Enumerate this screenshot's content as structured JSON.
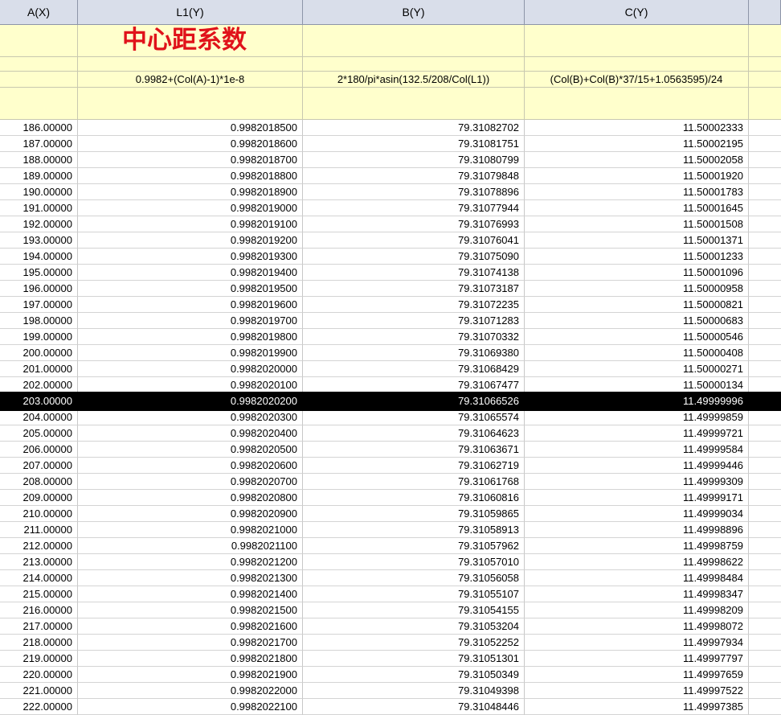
{
  "columns": [
    "A(X)",
    "L1(Y)",
    "B(Y)",
    "C(Y)",
    ""
  ],
  "meta": {
    "long_name": "中心距系数",
    "formulas": [
      "",
      "0.9982+(Col(A)-1)*1e-8",
      "2*180/pi*asin(132.5/208/Col(L1))",
      "(Col(B)+Col(B)*37/15+1.0563595)/24",
      ""
    ]
  },
  "selected_row_index": 17,
  "rows": [
    [
      "186.00000",
      "0.9982018500",
      "79.31082702",
      "11.50002333"
    ],
    [
      "187.00000",
      "0.9982018600",
      "79.31081751",
      "11.50002195"
    ],
    [
      "188.00000",
      "0.9982018700",
      "79.31080799",
      "11.50002058"
    ],
    [
      "189.00000",
      "0.9982018800",
      "79.31079848",
      "11.50001920"
    ],
    [
      "190.00000",
      "0.9982018900",
      "79.31078896",
      "11.50001783"
    ],
    [
      "191.00000",
      "0.9982019000",
      "79.31077944",
      "11.50001645"
    ],
    [
      "192.00000",
      "0.9982019100",
      "79.31076993",
      "11.50001508"
    ],
    [
      "193.00000",
      "0.9982019200",
      "79.31076041",
      "11.50001371"
    ],
    [
      "194.00000",
      "0.9982019300",
      "79.31075090",
      "11.50001233"
    ],
    [
      "195.00000",
      "0.9982019400",
      "79.31074138",
      "11.50001096"
    ],
    [
      "196.00000",
      "0.9982019500",
      "79.31073187",
      "11.50000958"
    ],
    [
      "197.00000",
      "0.9982019600",
      "79.31072235",
      "11.50000821"
    ],
    [
      "198.00000",
      "0.9982019700",
      "79.31071283",
      "11.50000683"
    ],
    [
      "199.00000",
      "0.9982019800",
      "79.31070332",
      "11.50000546"
    ],
    [
      "200.00000",
      "0.9982019900",
      "79.31069380",
      "11.50000408"
    ],
    [
      "201.00000",
      "0.9982020000",
      "79.31068429",
      "11.50000271"
    ],
    [
      "202.00000",
      "0.9982020100",
      "79.31067477",
      "11.50000134"
    ],
    [
      "203.00000",
      "0.9982020200",
      "79.31066526",
      "11.49999996"
    ],
    [
      "204.00000",
      "0.9982020300",
      "79.31065574",
      "11.49999859"
    ],
    [
      "205.00000",
      "0.9982020400",
      "79.31064623",
      "11.49999721"
    ],
    [
      "206.00000",
      "0.9982020500",
      "79.31063671",
      "11.49999584"
    ],
    [
      "207.00000",
      "0.9982020600",
      "79.31062719",
      "11.49999446"
    ],
    [
      "208.00000",
      "0.9982020700",
      "79.31061768",
      "11.49999309"
    ],
    [
      "209.00000",
      "0.9982020800",
      "79.31060816",
      "11.49999171"
    ],
    [
      "210.00000",
      "0.9982020900",
      "79.31059865",
      "11.49999034"
    ],
    [
      "211.00000",
      "0.9982021000",
      "79.31058913",
      "11.49998896"
    ],
    [
      "212.00000",
      "0.9982021100",
      "79.31057962",
      "11.49998759"
    ],
    [
      "213.00000",
      "0.9982021200",
      "79.31057010",
      "11.49998622"
    ],
    [
      "214.00000",
      "0.9982021300",
      "79.31056058",
      "11.49998484"
    ],
    [
      "215.00000",
      "0.9982021400",
      "79.31055107",
      "11.49998347"
    ],
    [
      "216.00000",
      "0.9982021500",
      "79.31054155",
      "11.49998209"
    ],
    [
      "217.00000",
      "0.9982021600",
      "79.31053204",
      "11.49998072"
    ],
    [
      "218.00000",
      "0.9982021700",
      "79.31052252",
      "11.49997934"
    ],
    [
      "219.00000",
      "0.9982021800",
      "79.31051301",
      "11.49997797"
    ],
    [
      "220.00000",
      "0.9982021900",
      "79.31050349",
      "11.49997659"
    ],
    [
      "221.00000",
      "0.9982022000",
      "79.31049398",
      "11.49997522"
    ],
    [
      "222.00000",
      "0.9982022100",
      "79.31048446",
      "11.49997385"
    ]
  ]
}
